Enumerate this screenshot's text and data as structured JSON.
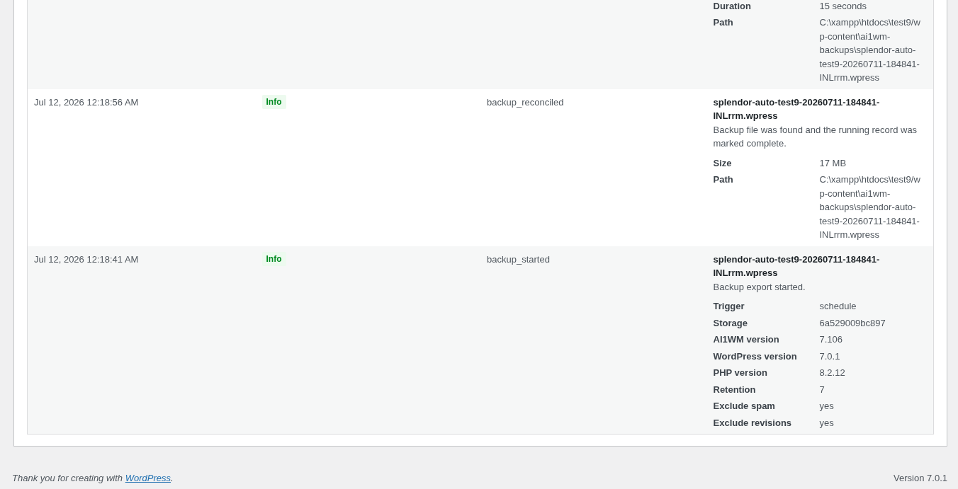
{
  "log_table": {
    "rows": [
      {
        "details": {
          "fields": [
            {
              "label": "Duration",
              "value": "15 seconds"
            },
            {
              "label": "Path",
              "value": "C:\\xampp\\htdocs\\test9/wp-content\\ai1wm-backups\\splendor-auto-test9-20260711-184841-INLrrm.wpress"
            }
          ]
        }
      },
      {
        "time": "Jul 12, 2026 12:18:56 AM",
        "level": {
          "label": "Info",
          "kind": "info"
        },
        "event": "backup_reconciled",
        "details": {
          "title": "splendor-auto-test9-20260711-184841-INLrrm.wpress",
          "message": "Backup file was found and the running record was marked complete.",
          "fields": [
            {
              "label": "Size",
              "value": "17 MB"
            },
            {
              "label": "Path",
              "value": "C:\\xampp\\htdocs\\test9/wp-content\\ai1wm-backups\\splendor-auto-test9-20260711-184841-INLrrm.wpress"
            }
          ]
        }
      },
      {
        "time": "Jul 12, 2026 12:18:41 AM",
        "level": {
          "label": "Info",
          "kind": "info"
        },
        "event": "backup_started",
        "details": {
          "title": "splendor-auto-test9-20260711-184841-INLrrm.wpress",
          "message": "Backup export started.",
          "fields": [
            {
              "label": "Trigger",
              "value": "schedule"
            },
            {
              "label": "Storage",
              "value": "6a529009bc897"
            },
            {
              "label": "AI1WM version",
              "value": "7.106"
            },
            {
              "label": "WordPress version",
              "value": "7.0.1"
            },
            {
              "label": "PHP version",
              "value": "8.2.12"
            },
            {
              "label": "Retention",
              "value": "7"
            },
            {
              "label": "Exclude spam",
              "value": "yes"
            },
            {
              "label": "Exclude revisions",
              "value": "yes"
            }
          ]
        }
      }
    ]
  },
  "footer": {
    "thanks": "Thank you for creating with ",
    "link": "WordPress",
    "after": ".",
    "version": "Version 7.0.1"
  }
}
